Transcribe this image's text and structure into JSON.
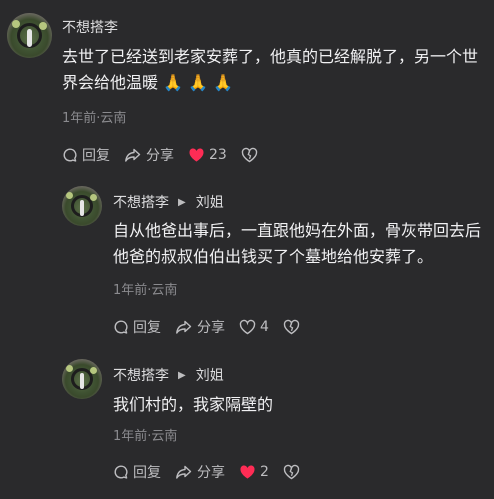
{
  "comments": [
    {
      "author": "不想搭李",
      "text": "去世了已经送到老家安葬了，他真的已经解脱了，另一个世界会给他温暖 🙏 🙏 🙏",
      "meta": "1年前·云南",
      "reply_label": "回复",
      "share_label": "分享",
      "like_count": "23",
      "liked": true
    },
    {
      "author": "不想搭李",
      "reply_to": "刘姐",
      "text": "自从他爸出事后，一直跟他妈在外面，骨灰带回去后他爸的叔叔伯伯出钱买了个墓地给他安葬了。",
      "meta": "1年前·云南",
      "reply_label": "回复",
      "share_label": "分享",
      "like_count": "4",
      "liked": false
    },
    {
      "author": "不想搭李",
      "reply_to": "刘姐",
      "text": "我们村的，我家隔壁的",
      "meta": "1年前·云南",
      "reply_label": "回复",
      "share_label": "分享",
      "like_count": "2",
      "liked": true
    }
  ],
  "colors": {
    "background": "#2a2a2c",
    "liked_heart": "#fe2c55",
    "meta_text": "#8a8a8e"
  }
}
